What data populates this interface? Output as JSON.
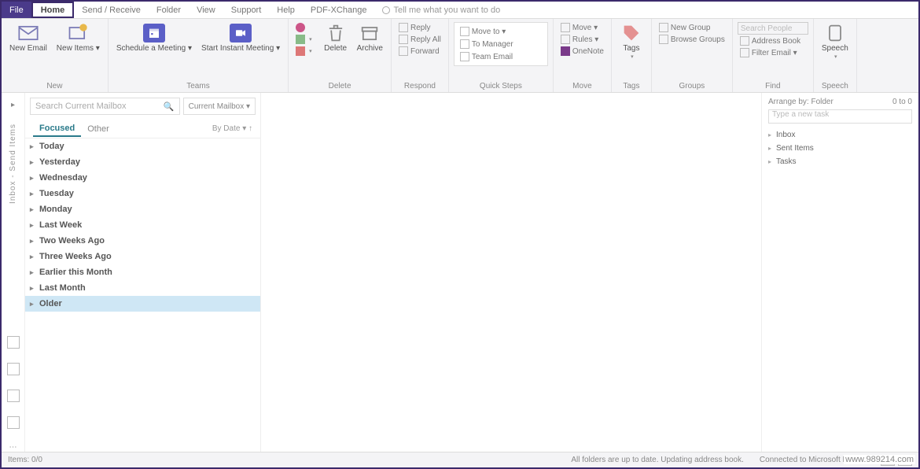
{
  "tabs": {
    "file": "File",
    "home": "Home",
    "sendrecv": "Send / Receive",
    "folder": "Folder",
    "view": "View",
    "support": "Support",
    "help": "Help",
    "pdfx": "PDF-XChange",
    "tell": "Tell me what you want to do"
  },
  "ribbon": {
    "new": {
      "email": "New Email",
      "items": "New Items ▾",
      "label": "New"
    },
    "teams": {
      "schedule": "Schedule a Meeting ▾",
      "instant": "Start Instant Meeting ▾",
      "label": "Teams"
    },
    "delete": {
      "ignore_ic": "ignore",
      "cleanup_ic": "cleanup",
      "junk_ic": "junk",
      "delete": "Delete",
      "archive": "Archive",
      "label": "Delete"
    },
    "respond": {
      "reply": "Reply",
      "replyall": "Reply All",
      "forward": "Forward",
      "label": "Respond"
    },
    "quicksteps": {
      "move": "Move to ▾",
      "manager": "To Manager",
      "teamemail": "Team Email",
      "label": "Quick Steps"
    },
    "move": {
      "move": "Move ▾",
      "rules": "Rules ▾",
      "onenote": "OneNote",
      "label": "Move"
    },
    "tags": {
      "tags": "Tags",
      "label": "Tags"
    },
    "groups": {
      "newgroup": "New Group",
      "browse": "Browse Groups",
      "label": "Groups"
    },
    "find": {
      "search": "Search People",
      "address": "Address Book",
      "filter": "Filter Email ▾",
      "label": "Find"
    },
    "speech": {
      "speech": "Speech",
      "label": "Speech"
    }
  },
  "leftrail": {
    "text": "Inbox - Send Items"
  },
  "search": {
    "placeholder": "Search Current Mailbox",
    "scope": "Current Mailbox ▾"
  },
  "mailtabs": {
    "focused": "Focused",
    "other": "Other",
    "sort": "By Date ▾  ↑"
  },
  "groups": [
    "Today",
    "Yesterday",
    "Wednesday",
    "Tuesday",
    "Monday",
    "Last Week",
    "Two Weeks Ago",
    "Three Weeks Ago",
    "Earlier this Month",
    "Last Month",
    "Older"
  ],
  "todo": {
    "header": "Arrange by: Folder",
    "count": "0 to 0",
    "input": "Type a new task",
    "items": [
      "Inbox",
      "Sent Items",
      "Tasks"
    ]
  },
  "status": {
    "left": "Items: 0/0",
    "mid": "All folders are up to date.  Updating address book.",
    "right": "Connected to Microsoft Exchange"
  },
  "watermark": "www.989214.com"
}
